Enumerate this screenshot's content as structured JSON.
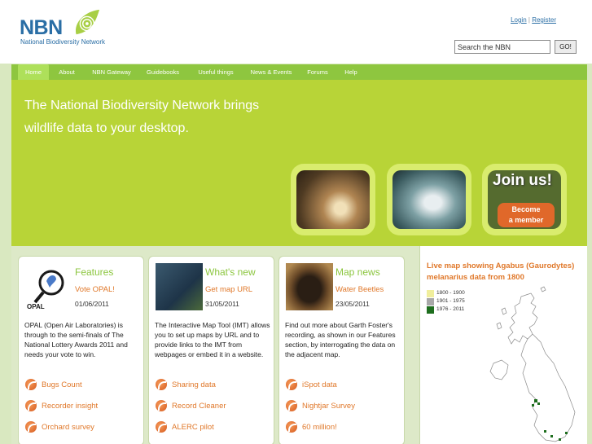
{
  "header": {
    "logo_text": "NBN",
    "logo_sub": "National Biodiversity Network",
    "login_label": "Login",
    "separator": "|",
    "register_label": "Register",
    "search_value": "Search the NBN",
    "search_button": "GO!"
  },
  "nav": {
    "items": [
      {
        "label": "Home"
      },
      {
        "label": "About"
      },
      {
        "label": "NBN Gateway"
      },
      {
        "label": "Guidebooks"
      },
      {
        "label": "Useful things"
      },
      {
        "label": "News & Events"
      },
      {
        "label": "Forums"
      },
      {
        "label": "Help"
      }
    ]
  },
  "hero": {
    "line1": "The National Biodiversity Network brings",
    "line2": "wildlife data to your desktop.",
    "join_title": "Join us!",
    "join_button_line1": "Become",
    "join_button_line2": "a member"
  },
  "columns": [
    {
      "heading": "Features",
      "link": "Vote OPAL!",
      "date": "01/06/2011",
      "logo_text": "OPAL",
      "body": "OPAL (Open Air Laboratories) is through to the semi-finals of The National Lottery Awards 2011 and needs your vote to win.",
      "links": [
        "Bugs Count",
        "Recorder insight",
        "Orchard survey"
      ]
    },
    {
      "heading": "What's new",
      "link": "Get map URL",
      "date": "31/05/2011",
      "body": "The Interactive Map Tool (IMT) allows you to set up maps by URL and to provide links to the IMT from webpages or embed it in a website.",
      "links": [
        "Sharing data",
        "Record Cleaner",
        "ALERC pilot"
      ]
    },
    {
      "heading": "Map news",
      "link": "Water Beetles",
      "date": "23/05/2011",
      "body": "Find out more about Garth Foster's recording, as shown in our Features section, by interrogating the data on the adjacent map.",
      "links": [
        "iSpot data",
        "Nightjar Survey",
        "60 million!"
      ]
    }
  ],
  "map": {
    "title": "Live map showing Agabus (Gaurodytes) melanarius data from 1800",
    "legend": [
      {
        "label": "1800 - 1900",
        "color": "#f0ee9c"
      },
      {
        "label": "1901 - 1975",
        "color": "#a8a8a8"
      },
      {
        "label": "1976 - 2011",
        "color": "#1e6e1e"
      }
    ]
  },
  "colors": {
    "nav_green": "#8ec63f",
    "hero_green": "#b8d437",
    "accent_orange": "#e0782a",
    "link_blue": "#2a6ea5"
  }
}
